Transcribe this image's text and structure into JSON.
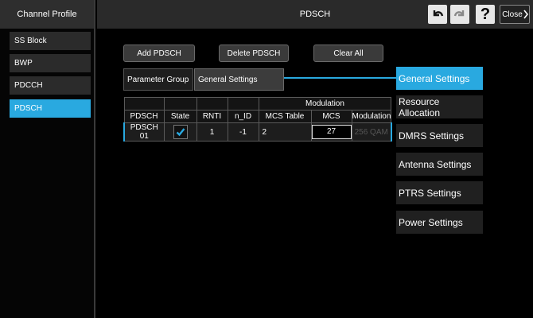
{
  "sidebar": {
    "title": "Channel Profile",
    "items": [
      {
        "label": "SS Block"
      },
      {
        "label": "BWP"
      },
      {
        "label": "PDCCH"
      },
      {
        "label": "PDSCH"
      }
    ]
  },
  "header": {
    "title": "PDSCH",
    "close_label": "Close"
  },
  "toolbar": {
    "add_label": "Add PDSCH",
    "delete_label": "Delete PDSCH",
    "clear_label": "Clear All"
  },
  "param_group": {
    "label": "Parameter Group",
    "value": "General Settings"
  },
  "table": {
    "group_header": "Modulation",
    "columns": [
      "PDSCH",
      "State",
      "RNTI",
      "n_ID",
      "MCS Table",
      "MCS",
      "Modulation"
    ],
    "rows": [
      {
        "pdsch": "PDSCH 01",
        "state": true,
        "rnti": "1",
        "n_id": "-1",
        "mcs_table": "2",
        "mcs": "27",
        "modulation": "256 QAM"
      }
    ]
  },
  "categories": [
    {
      "label": "General Settings",
      "active": true
    },
    {
      "label": "Resource Allocation"
    },
    {
      "label": "DMRS Settings"
    },
    {
      "label": "Antenna Settings"
    },
    {
      "label": "PTRS Settings"
    },
    {
      "label": "Power Settings"
    }
  ],
  "colors": {
    "accent": "#29a9e0",
    "background": "#000000",
    "panel": "#2a2a2a"
  }
}
